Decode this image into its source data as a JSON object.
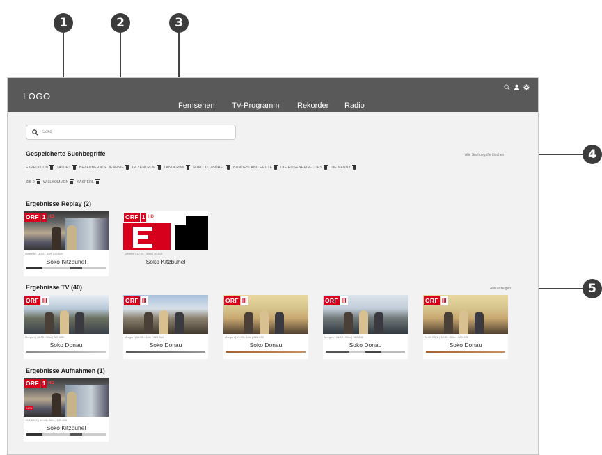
{
  "callouts": [
    "1",
    "2",
    "3",
    "4",
    "5"
  ],
  "header": {
    "logo": "LOGO",
    "nav": [
      "Fernsehen",
      "TV-Programm",
      "Rekorder",
      "Radio"
    ]
  },
  "search": {
    "value": "Soko"
  },
  "saved": {
    "title": "Gespeicherte Suchbegriffe",
    "clear_all": "Alle Suchbegriffe löschen",
    "chips_row1": [
      "EXPEDITION",
      "TATORT",
      "BEZAUBERNDE JEANNIE",
      "IM ZENTRUM",
      "LANDKRIMI",
      "SOKO KITZBÜHEL",
      "BUNDESLAND HEUTE",
      "DIE ROSENHEIM-COPS",
      "DIE NANNY"
    ],
    "chips_row2": [
      "ZIB 2",
      "WILLKOMMEN",
      "KASPERL"
    ]
  },
  "replay": {
    "title": "Ergebnisse Replay (2)",
    "items": [
      {
        "channel": "ORF",
        "num": "1",
        "hd": "HD",
        "meta": "Gestern | 16:05 - 45m | 29 830",
        "title": "Soko Kitzbühel"
      },
      {
        "channel": "ORF",
        "num": "1",
        "hd": "HD",
        "meta": "Gestern | 17:05 - 45m | 30 815",
        "title": "Soko Kitzbühel"
      }
    ]
  },
  "tv": {
    "title": "Ergebnisse TV (40)",
    "show_all": "Alle anzeigen",
    "items": [
      {
        "channel": "ORF",
        "num": "III",
        "meta": "Morgen | 16:05 - 50m | 323 832",
        "title": "Soko Donau"
      },
      {
        "channel": "ORF",
        "num": "III",
        "meta": "Morgen | 16:55 - 45m | 323 834",
        "title": "Soko Donau"
      },
      {
        "channel": "ORF",
        "num": "III",
        "meta": "Morgen | 17:40 - 45m | 328 835",
        "title": "Soko Donau"
      },
      {
        "channel": "ORF",
        "num": "III",
        "meta": "Morgen | 18:25 - 55m | 323 838",
        "title": "Soko Donau"
      },
      {
        "channel": "ORF",
        "num": "III",
        "meta": "24.03.2022 | 15:35 - 50m | 323 835",
        "title": "Soko Donau"
      }
    ]
  },
  "recordings": {
    "title": "Ergebnisse Aufnahmen (1)",
    "items": [
      {
        "channel": "ORF",
        "num": "1",
        "hd": "HD",
        "badge": "NEU",
        "meta": "19.2.2022 | 15:44 - 52m | 135 835",
        "title": "Soko Kitzbühel"
      }
    ]
  },
  "colors": {
    "header": "#595959",
    "brand_red": "#d6001c",
    "background": "#f2f2f2"
  },
  "icons": [
    "search-icon",
    "user-icon",
    "gear-icon",
    "trash-icon"
  ]
}
